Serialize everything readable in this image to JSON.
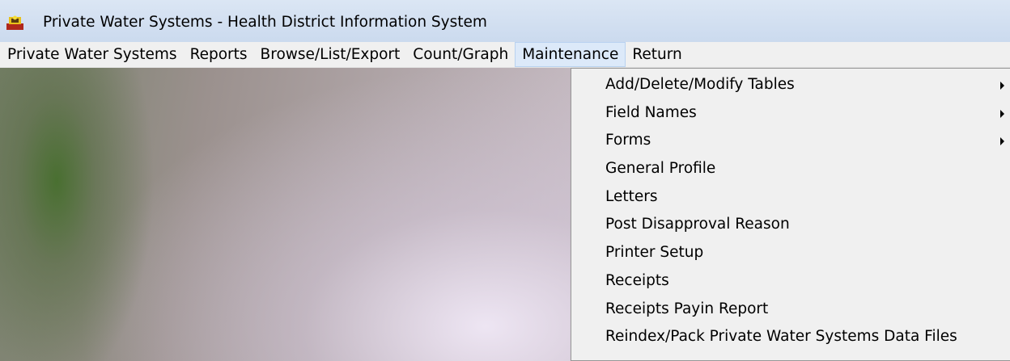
{
  "window": {
    "title": "Private Water Systems - Health District Information System",
    "icon": "app-icon"
  },
  "menubar": {
    "items": [
      {
        "label": "Private Water Systems"
      },
      {
        "label": "Reports"
      },
      {
        "label": "Browse/List/Export"
      },
      {
        "label": "Count/Graph"
      },
      {
        "label": "Maintenance",
        "active": true
      },
      {
        "label": "Return"
      }
    ]
  },
  "maintenance_menu": {
    "items": [
      {
        "label": "Add/Delete/Modify Tables",
        "submenu": true
      },
      {
        "label": "Field Names",
        "submenu": true
      },
      {
        "label": "Forms",
        "submenu": true
      },
      {
        "label": "General Profile"
      },
      {
        "label": "Letters"
      },
      {
        "label": "Post Disapproval Reason"
      },
      {
        "label": "Printer Setup"
      },
      {
        "label": "Receipts"
      },
      {
        "label": "Receipts Payin Report"
      },
      {
        "label": "Reindex/Pack Private Water Systems Data Files"
      }
    ]
  },
  "colors": {
    "titlebar": "#cbdaee",
    "menubar": "#f0f0f0",
    "menu_active_highlight": "#dce9f9",
    "dropdown_bg": "#f0f0f0"
  }
}
